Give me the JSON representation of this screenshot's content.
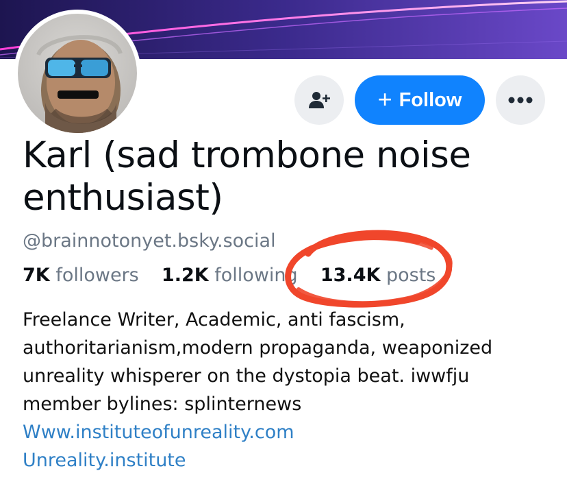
{
  "profile": {
    "display_name": "Karl (sad trombone noise enthusiast)",
    "handle": "@brainnotonyet.bsky.social",
    "avatar_alt": "profile photo with sunglasses"
  },
  "stats": {
    "followers_count": "7K",
    "followers_label": "followers",
    "following_count": "1.2K",
    "following_label": "following",
    "posts_count": "13.4K",
    "posts_label": "posts"
  },
  "actions": {
    "follow_label": "Follow",
    "add_user_icon": "person-plus-icon",
    "more_icon": "ellipsis-icon"
  },
  "bio": {
    "lines": [
      "Freelance Writer, Academic, anti fascism,",
      "authoritarianism,modern propaganda, weaponized",
      "unreality whisperer on the dystopia beat. iwwfju",
      "member bylines: splinternews"
    ],
    "links": [
      "Www.instituteofunreality.com",
      "Unreality.institute"
    ]
  },
  "colors": {
    "follow_button": "#1083fe",
    "link": "#2f80c6",
    "muted_text": "#6b7785",
    "annotation_circle": "#f0462b"
  }
}
